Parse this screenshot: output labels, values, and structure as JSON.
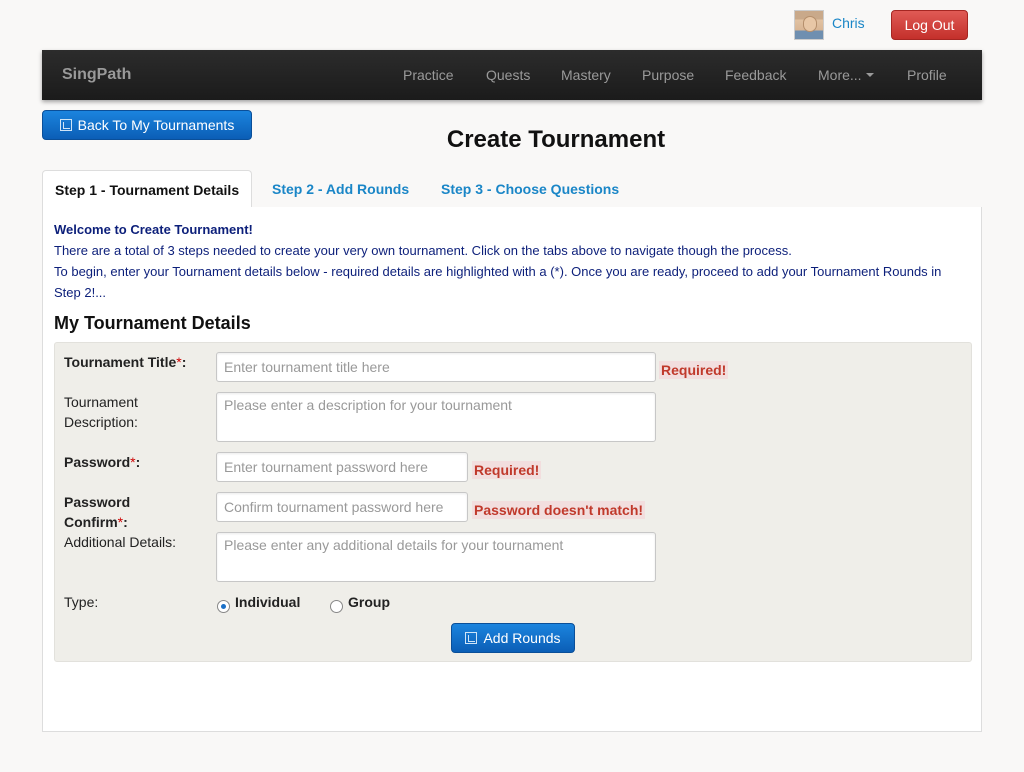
{
  "user": {
    "name": "Chris",
    "logout_label": "Log Out"
  },
  "navbar": {
    "brand": "SingPath",
    "items": [
      {
        "label": "Practice"
      },
      {
        "label": "Quests"
      },
      {
        "label": "Mastery"
      },
      {
        "label": "Purpose"
      },
      {
        "label": "Feedback"
      },
      {
        "label": "More..."
      },
      {
        "label": "Profile"
      }
    ]
  },
  "back_button_label": "Back To My Tournaments",
  "page_title": "Create Tournament",
  "tabs": [
    {
      "label": "Step 1 - Tournament Details",
      "active": true
    },
    {
      "label": "Step 2 - Add Rounds",
      "active": false
    },
    {
      "label": "Step 3 - Choose Questions",
      "active": false
    }
  ],
  "welcome": {
    "heading": "Welcome to Create Tournament!",
    "line1": "There are a total of 3 steps needed to create your very own tournament. Click on the tabs above to navigate though the process.",
    "line2": "To begin, enter your Tournament details below - required details are highlighted with a (*). Once you are ready, proceed to add your Tournament Rounds in Step 2!..."
  },
  "section_title": "My Tournament Details",
  "form": {
    "title": {
      "label": "Tournament Title",
      "star": "*",
      "colon": ":",
      "placeholder": "Enter tournament title here",
      "error": "Required!"
    },
    "description": {
      "label": "Tournament Description:",
      "placeholder": "Please enter a description for your tournament"
    },
    "password": {
      "label": "Password",
      "star": "*",
      "colon": ":",
      "placeholder": "Enter tournament password here",
      "error": "Required!"
    },
    "password_confirm": {
      "label": "Password Confirm",
      "star": "*",
      "colon": ":",
      "placeholder": "Confirm tournament password here",
      "error": "Password doesn't match!"
    },
    "additional": {
      "label": "Additional Details:",
      "placeholder": "Please enter any additional details for your tournament"
    },
    "type": {
      "label": "Type:",
      "options": [
        "Individual",
        "Group"
      ],
      "selected": "Individual"
    },
    "submit_label": "Add Rounds"
  },
  "colors": {
    "primary_button": "#0b5eb6",
    "danger_button": "#c4302b",
    "link": "#1a86c7",
    "navbar": "#1b1b1b",
    "error_text": "#c0392b"
  }
}
